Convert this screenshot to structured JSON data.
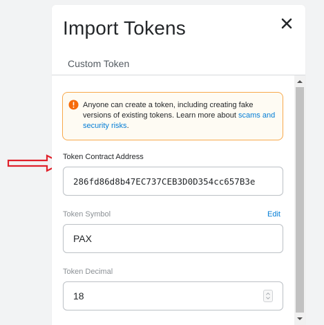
{
  "dialog": {
    "title": "Import Tokens",
    "tab_label": "Custom Token"
  },
  "warning": {
    "text": "Anyone can create a token, including creating fake versions of existing tokens. Learn more about ",
    "link_text": "scams and security risks",
    "text_end": "."
  },
  "form": {
    "contract_address_label": "Token Contract Address",
    "contract_address_value": "286fd86d8b47EC737CEB3D0D354cc657B3e",
    "symbol_label": "Token Symbol",
    "symbol_edit": "Edit",
    "symbol_value": "PAX",
    "decimal_label": "Token Decimal",
    "decimal_value": "18"
  },
  "colors": {
    "annotation_arrow": "#e0202a",
    "warning_border": "#f8a84a",
    "link": "#037dd6"
  },
  "icons": {
    "close": "close-icon",
    "warning": "info-warning-icon",
    "annotation": "arrow-right-annotation-icon"
  }
}
